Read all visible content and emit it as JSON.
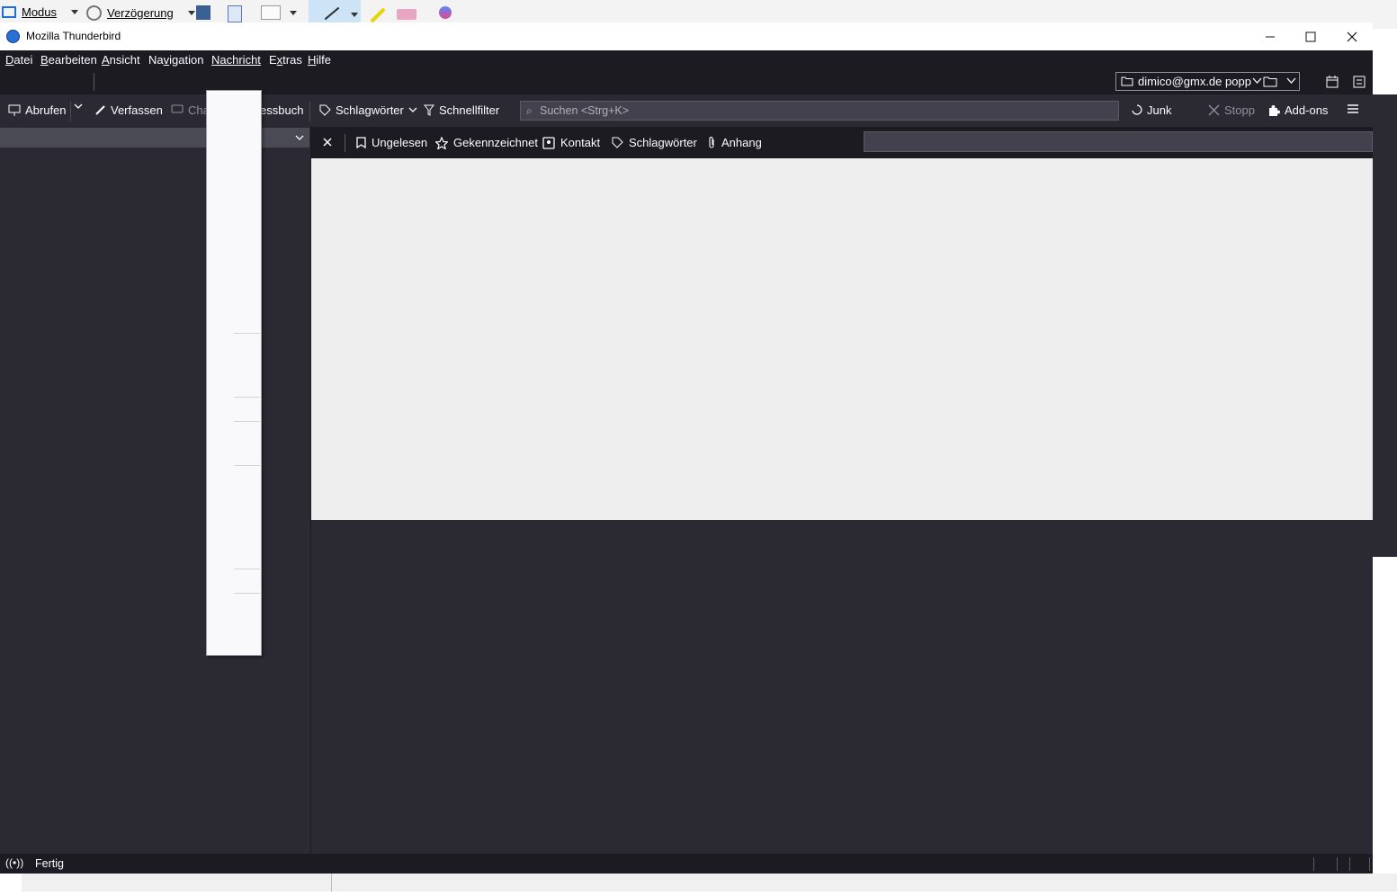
{
  "snip_toolbar": {
    "mode_label": "Modus",
    "delay_label": "Verzögerung"
  },
  "window": {
    "title": "Mozilla Thunderbird",
    "app_icon": "thunderbird-icon",
    "controls": [
      "minimize-icon",
      "maximize-icon",
      "close-icon"
    ]
  },
  "menubar": {
    "items": [
      {
        "label": "Datei",
        "accesskey": "D"
      },
      {
        "label": "Bearbeiten",
        "accesskey": "B"
      },
      {
        "label": "Ansicht",
        "accesskey": "A"
      },
      {
        "label": "Navigation",
        "accesskey": "v"
      },
      {
        "label": "Nachricht",
        "accesskey": "N"
      },
      {
        "label": "Extras",
        "accesskey": "x"
      },
      {
        "label": "Hilfe",
        "accesskey": "H"
      }
    ],
    "open_menu": "Nachricht"
  },
  "tabrow": {
    "account_folder": "dimico@gmx.de popp"
  },
  "toolbar": {
    "abrufen": "Abrufen",
    "verfassen": "Verfassen",
    "chat_partial": "Cha",
    "adressbuch_partial": "essbuch",
    "schlagwoerter": "Schlagwörter",
    "schnellfilter": "Schnellfilter",
    "search_placeholder": "Suchen <Strg+K>",
    "junk": "Junk",
    "stopp": "Stopp",
    "addons": "Add-ons"
  },
  "quickfilter": {
    "ungelesen": "Ungelesen",
    "gekennzeichnet": "Gekennzeichnet",
    "kontakt": "Kontakt",
    "schlagwoerter": "Schlagwörter",
    "anhang": "Anhang"
  },
  "statusbar": {
    "text": "Fertig"
  },
  "colors": {
    "window_bg": "#1c1b22",
    "pane_bg": "#2b2a33",
    "thread_pane_bg": "#eeeeee",
    "menu_bg": "#f9f9fb"
  }
}
